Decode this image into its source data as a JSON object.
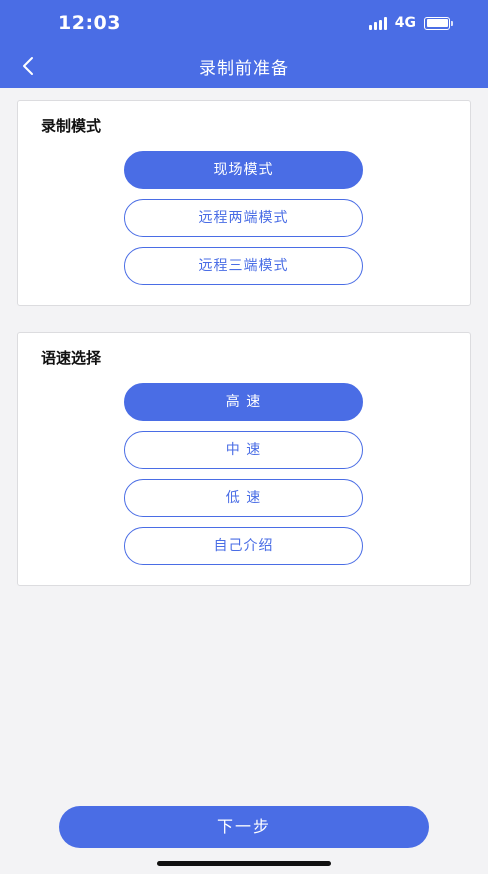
{
  "status_bar": {
    "time": "12:03",
    "network": "4G"
  },
  "nav": {
    "title": "录制前准备"
  },
  "recording_mode": {
    "title": "录制模式",
    "options": [
      {
        "label": "现场模式",
        "selected": true
      },
      {
        "label": "远程两端模式",
        "selected": false
      },
      {
        "label": "远程三端模式",
        "selected": false
      }
    ]
  },
  "speed": {
    "title": "语速选择",
    "options": [
      {
        "label": "高 速",
        "selected": true
      },
      {
        "label": "中 速",
        "selected": false
      },
      {
        "label": "低 速",
        "selected": false
      },
      {
        "label": "自己介绍",
        "selected": false
      }
    ]
  },
  "footer": {
    "next_label": "下一步"
  },
  "colors": {
    "accent": "#4a6de5",
    "background": "#f3f3f5"
  },
  "icons": {
    "back": "chevron-left-icon",
    "signal": "signal-icon",
    "battery": "battery-icon"
  }
}
